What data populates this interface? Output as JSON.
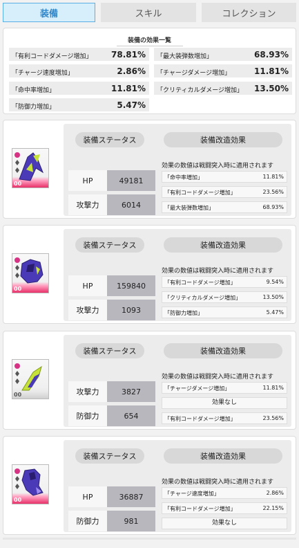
{
  "tabs": [
    {
      "label": "装備"
    },
    {
      "label": "スキル"
    },
    {
      "label": "コレクション"
    }
  ],
  "summary": {
    "title": "装備の効果一覧",
    "effects": [
      {
        "name": "「有利コードダメージ増加」",
        "value": "78.81%"
      },
      {
        "name": "「最大装弾数増加」",
        "value": "68.93%"
      },
      {
        "name": "「チャージ速度増加」",
        "value": "2.86%"
      },
      {
        "name": "「チャージダメージ増加」",
        "value": "11.81%"
      },
      {
        "name": "「命中率増加」",
        "value": "11.81%"
      },
      {
        "name": "「クリティカルダメージ増加」",
        "value": "13.50%"
      },
      {
        "name": "「防御力増加」",
        "value": "5.47%"
      }
    ]
  },
  "labels": {
    "status": "装備ステータス",
    "mod": "装備改造効果",
    "note": "効果の数値は戦闘突入時に適用されます",
    "none": "効果なし",
    "level": "00"
  },
  "cards": [
    {
      "stats": [
        {
          "label": "HP",
          "value": "49181"
        },
        {
          "label": "攻撃力",
          "value": "6014"
        }
      ],
      "mods": [
        {
          "name": "「命中率増加」",
          "value": "11.81%"
        },
        {
          "name": "「有利コードダメージ増加」",
          "value": "23.56%"
        },
        {
          "name": "「最大装弾数増加」",
          "value": "68.93%"
        }
      ]
    },
    {
      "stats": [
        {
          "label": "HP",
          "value": "159840"
        },
        {
          "label": "攻撃力",
          "value": "1093"
        }
      ],
      "mods": [
        {
          "name": "「有利コードダメージ増加」",
          "value": "9.54%"
        },
        {
          "name": "「クリティカルダメージ増加」",
          "value": "13.50%"
        },
        {
          "name": "「防御力増加」",
          "value": "5.47%"
        }
      ]
    },
    {
      "stats": [
        {
          "label": "攻撃力",
          "value": "3827"
        },
        {
          "label": "防御力",
          "value": "654"
        }
      ],
      "mods": [
        {
          "name": "「チャージダメージ増加」",
          "value": "11.81%"
        },
        {
          "name": "",
          "value": ""
        },
        {
          "name": "「有利コードダメージ増加」",
          "value": "23.56%"
        }
      ]
    },
    {
      "stats": [
        {
          "label": "HP",
          "value": "36887"
        },
        {
          "label": "防御力",
          "value": "981"
        }
      ],
      "mods": [
        {
          "name": "「チャージ速度増加」",
          "value": "2.86%"
        },
        {
          "name": "「有利コードダメージ増加」",
          "value": "22.15%"
        },
        {
          "name": "",
          "value": ""
        }
      ]
    }
  ],
  "colors": {
    "accent": "#2f86c9",
    "pink": "#e8306a",
    "item_purple": "#4a3ab8",
    "item_green": "#c6e23a"
  }
}
